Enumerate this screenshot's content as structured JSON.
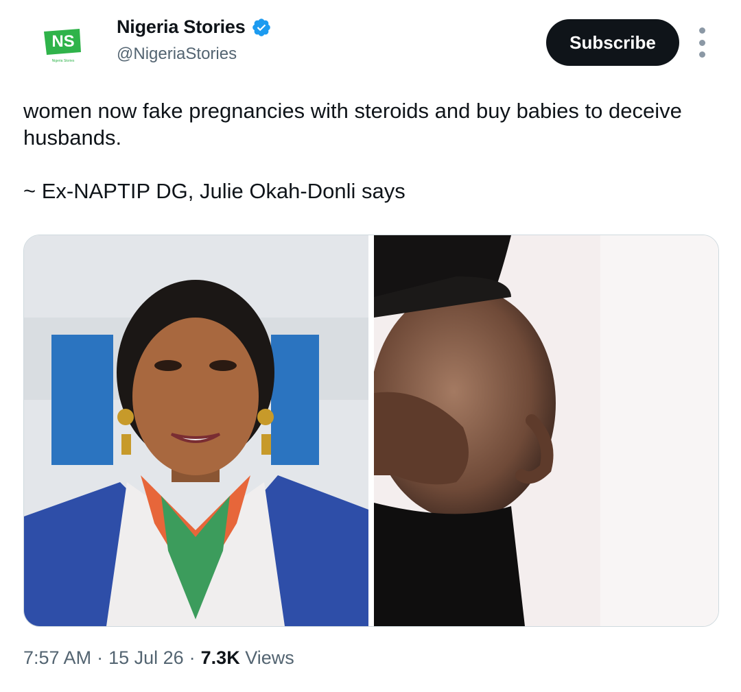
{
  "author": {
    "display_name": "Nigeria Stories",
    "handle": "@NigeriaStories",
    "verified": true,
    "avatar_logo_text": "NS",
    "avatar_logo_subtext": "Nigeria Stories"
  },
  "actions": {
    "subscribe_label": "Subscribe",
    "more_icon": "more-vertical-icon"
  },
  "tweet": {
    "lines": [
      "women now fake pregnancies with steroids and buy babies to deceive husbands.",
      "~ Ex-NAPTIP DG, Julie Okah-Donli says"
    ]
  },
  "media": {
    "count": 2
  },
  "meta": {
    "time": "7:57 AM",
    "separator": "·",
    "date": "15 Jul 26",
    "views_count": "7.3K",
    "views_label": "Views"
  },
  "colors": {
    "text_primary": "#0f1419",
    "text_secondary": "#536471",
    "verified_blue": "#1d9bf0",
    "logo_green": "#2fb34a",
    "button_bg": "#0f1419"
  }
}
